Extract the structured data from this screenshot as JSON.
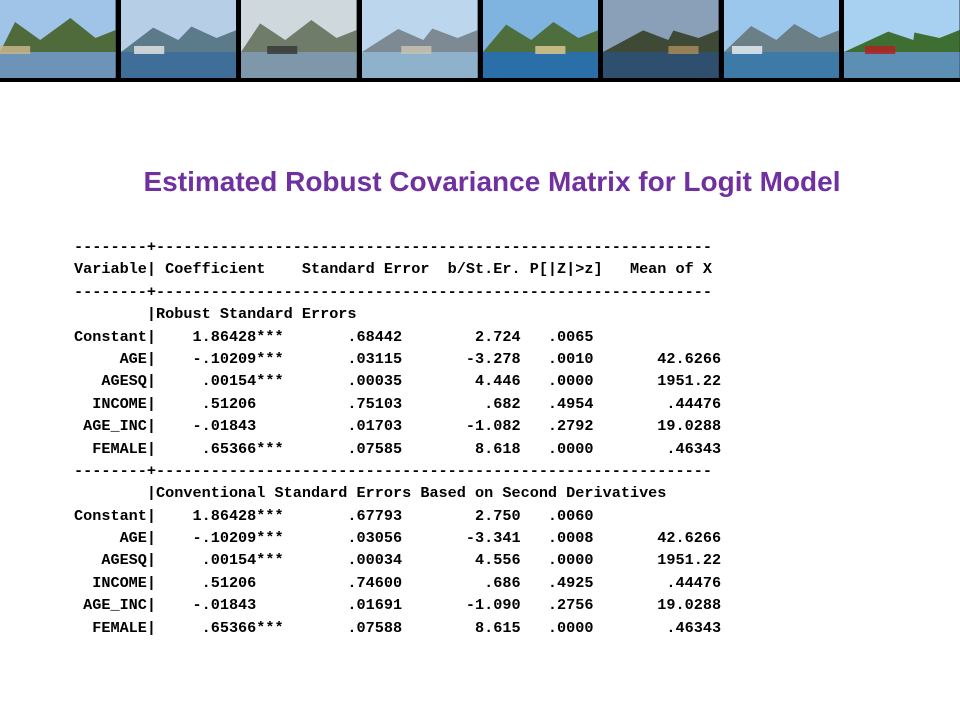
{
  "title": "Estimated Robust Covariance Matrix for Logit Model",
  "banner": {
    "photos": [
      {
        "sky": "#9fc4e8",
        "mountain": "#4f6b3c",
        "water": "#6d94b8",
        "accent": "#c9b48a"
      },
      {
        "sky": "#b7cfe6",
        "mountain": "#5b7a8a",
        "water": "#3f6f98",
        "accent": "#e0e0e0"
      },
      {
        "sky": "#cfd8dc",
        "mountain": "#6f7c6a",
        "water": "#7f97aa",
        "accent": "#3b3b3b"
      },
      {
        "sky": "#bcd6ee",
        "mountain": "#7d8a93",
        "water": "#8fb2cc",
        "accent": "#c8c1b0"
      },
      {
        "sky": "#7fb3e0",
        "mountain": "#4e6f3d",
        "water": "#2a6fa8",
        "accent": "#d9c78f"
      },
      {
        "sky": "#8a9fb8",
        "mountain": "#3e4a36",
        "water": "#2f4f6f",
        "accent": "#a88a5c"
      },
      {
        "sky": "#9cc7ec",
        "mountain": "#6a7f86",
        "water": "#3d7aa8",
        "accent": "#e3ecf2"
      },
      {
        "sky": "#a8d0f0",
        "mountain": "#3f6e33",
        "water": "#5d8fb5",
        "accent": "#b22222"
      }
    ]
  },
  "output_lines": [
    "--------+-------------------------------------------------------------",
    "Variable| Coefficient    Standard Error  b/St.Er. P[|Z|>z]   Mean of X",
    "--------+-------------------------------------------------------------",
    "        |Robust Standard Errors",
    "Constant|    1.86428***       .68442        2.724   .0065",
    "     AGE|    -.10209***       .03115       -3.278   .0010       42.6266",
    "   AGESQ|     .00154***       .00035        4.446   .0000       1951.22",
    "  INCOME|     .51206          .75103         .682   .4954        .44476",
    " AGE_INC|    -.01843          .01703       -1.082   .2792       19.0288",
    "  FEMALE|     .65366***       .07585        8.618   .0000        .46343",
    "--------+-------------------------------------------------------------",
    "        |Conventional Standard Errors Based on Second Derivatives",
    "Constant|    1.86428***       .67793        2.750   .0060",
    "     AGE|    -.10209***       .03056       -3.341   .0008       42.6266",
    "   AGESQ|     .00154***       .00034        4.556   .0000       1951.22",
    "  INCOME|     .51206          .74600         .686   .4925        .44476",
    " AGE_INC|    -.01843          .01691       -1.090   .2756       19.0288",
    "  FEMALE|     .65366***       .07588        8.615   .0000        .46343"
  ]
}
